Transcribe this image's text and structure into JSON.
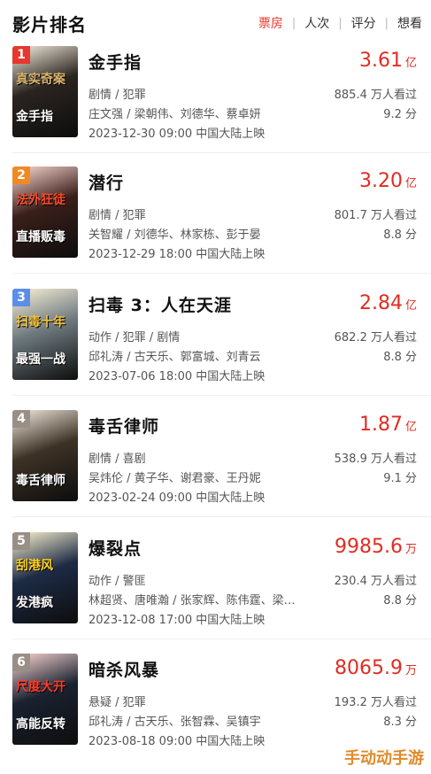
{
  "header": {
    "title": "影片排名",
    "tabs": [
      "票房",
      "人次",
      "评分",
      "想看"
    ],
    "active_tab": "票房"
  },
  "movies": [
    {
      "rank": "1",
      "title": "金手指",
      "box": "3.61",
      "unit": "亿",
      "genre": "剧情 / 犯罪",
      "cast": "庄文强 / 梁朝伟、刘德华、蔡卓妍",
      "release": "2023-12-30 09:00 中国大陆上映",
      "viewers": "885.4 万人看过",
      "score": "9.2 分",
      "poster_text": "真实奇案",
      "poster_text2": "金手指",
      "rank_color": "#e8372c",
      "poster_bg": "#2a2420",
      "poster_accent": "#d9b46b"
    },
    {
      "rank": "2",
      "title": "潜行",
      "box": "3.20",
      "unit": "亿",
      "genre": "剧情 / 犯罪",
      "cast": "关智耀 / 刘德华、林家栋、彭于晏",
      "release": "2023-12-29 18:00 中国大陆上映",
      "viewers": "801.7 万人看过",
      "score": "8.8 分",
      "poster_text": "法外狂徒",
      "poster_text2": "直播贩毒",
      "rank_color": "#f08a24",
      "poster_bg": "#3a1f1a",
      "poster_accent": "#ff4a2a"
    },
    {
      "rank": "3",
      "title": "扫毒 3：人在天涯",
      "box": "2.84",
      "unit": "亿",
      "genre": "动作 / 犯罪 / 剧情",
      "cast": "邱礼涛 / 古天乐、郭富城、刘青云",
      "release": "2023-07-06 18:00 中国大陆上映",
      "viewers": "682.2 万人看过",
      "score": "8.8 分",
      "poster_text": "扫毒十年",
      "poster_text2": "最强一战",
      "rank_color": "#5b8ee8",
      "poster_bg": "#6f7a80",
      "poster_accent": "#f0c040"
    },
    {
      "rank": "4",
      "title": "毒舌律师",
      "box": "1.87",
      "unit": "亿",
      "genre": "剧情 / 喜剧",
      "cast": "吴炜伦 / 黄子华、谢君豪、王丹妮",
      "release": "2023-02-24 09:00 中国大陆上映",
      "viewers": "538.9 万人看过",
      "score": "9.1 分",
      "poster_text": "",
      "poster_text2": "毒舌律师",
      "rank_color": "#9a8f86",
      "poster_bg": "#3d3226",
      "poster_accent": "#c9a46a"
    },
    {
      "rank": "5",
      "title": "爆裂点",
      "box": "9985.6",
      "unit": "万",
      "genre": "动作 / 警匪",
      "cast": "林超贤、唐唯瀚 / 张家辉、陈伟霆、梁…",
      "release": "2023-12-08 17:00 中国大陆上映",
      "viewers": "230.4 万人看过",
      "score": "8.8 分",
      "poster_text": "刮港风",
      "poster_text2": "发港疯",
      "rank_color": "#9a8f86",
      "poster_bg": "#1d2b45",
      "poster_accent": "#ffd21e"
    },
    {
      "rank": "6",
      "title": "暗杀风暴",
      "box": "8065.9",
      "unit": "万",
      "genre": "悬疑 / 犯罪",
      "cast": "邱礼涛 / 古天乐、张智霖、吴镇宇",
      "release": "2023-08-18 09:00 中国大陆上映",
      "viewers": "193.2 万人看过",
      "score": "8.3 分",
      "poster_text": "尺度大开",
      "poster_text2": "高能反转",
      "rank_color": "#9a8f86",
      "poster_bg": "#1a2230",
      "poster_accent": "#ff3b2a"
    }
  ],
  "watermark": "手动动手游"
}
